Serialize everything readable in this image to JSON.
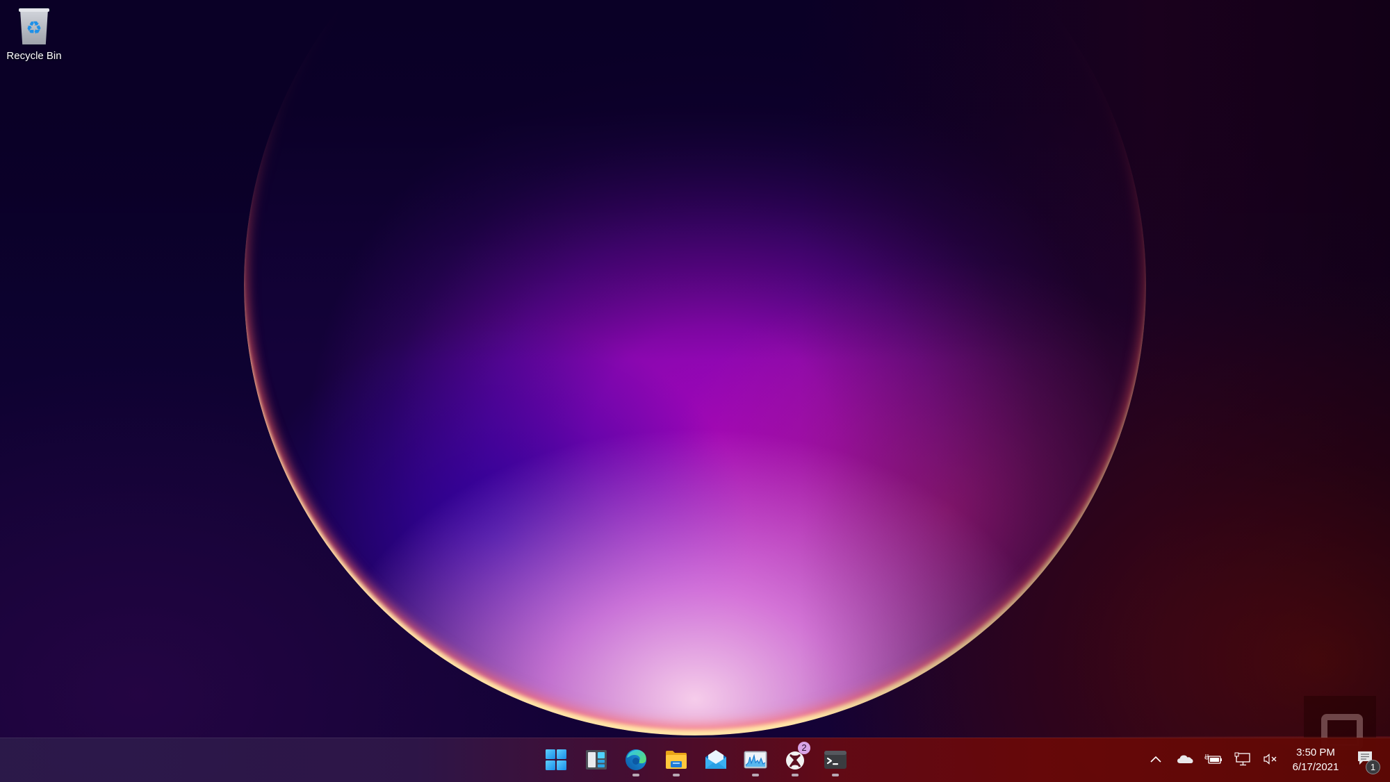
{
  "desktop": {
    "icons": [
      {
        "label": "Recycle Bin",
        "icon": "recycle-bin-icon"
      }
    ]
  },
  "wallpaper": {
    "name": "Windows 11 Bloom (Glow)",
    "colors": {
      "background": "#0a0026",
      "orb_center": "#a006b8",
      "orb_rim": "#ff4a6a",
      "orb_bottom_glow": "#ffe8b0",
      "right_glow": "#6e100a"
    }
  },
  "taskbar": {
    "apps": [
      {
        "name": "Start",
        "icon": "windows-start-icon",
        "running": false,
        "badge": null
      },
      {
        "name": "Widgets",
        "icon": "widgets-icon",
        "running": false,
        "badge": null
      },
      {
        "name": "Microsoft Edge",
        "icon": "edge-icon",
        "running": true,
        "badge": null
      },
      {
        "name": "File Explorer",
        "icon": "file-explorer-icon",
        "running": true,
        "badge": null
      },
      {
        "name": "Mail",
        "icon": "mail-icon",
        "running": false,
        "badge": null
      },
      {
        "name": "Performance Monitor",
        "icon": "performance-monitor-icon",
        "running": true,
        "badge": null
      },
      {
        "name": "Xbox",
        "icon": "xbox-icon",
        "running": true,
        "badge": "2"
      },
      {
        "name": "Windows Terminal",
        "icon": "terminal-icon",
        "running": true,
        "badge": null
      }
    ],
    "tray": {
      "items": [
        {
          "name": "Show hidden icons",
          "icon": "chevron-up-icon"
        },
        {
          "name": "OneDrive",
          "icon": "onedrive-cloud-icon"
        },
        {
          "name": "Battery",
          "icon": "battery-charging-icon"
        },
        {
          "name": "Network",
          "icon": "network-wired-icon"
        },
        {
          "name": "Volume muted",
          "icon": "volume-muted-icon"
        }
      ],
      "time": "3:50 PM",
      "date": "6/17/2021",
      "notifications_count": "1"
    }
  },
  "watermark": {
    "brand": "engadget",
    "icon": "engadget-logo-icon"
  }
}
